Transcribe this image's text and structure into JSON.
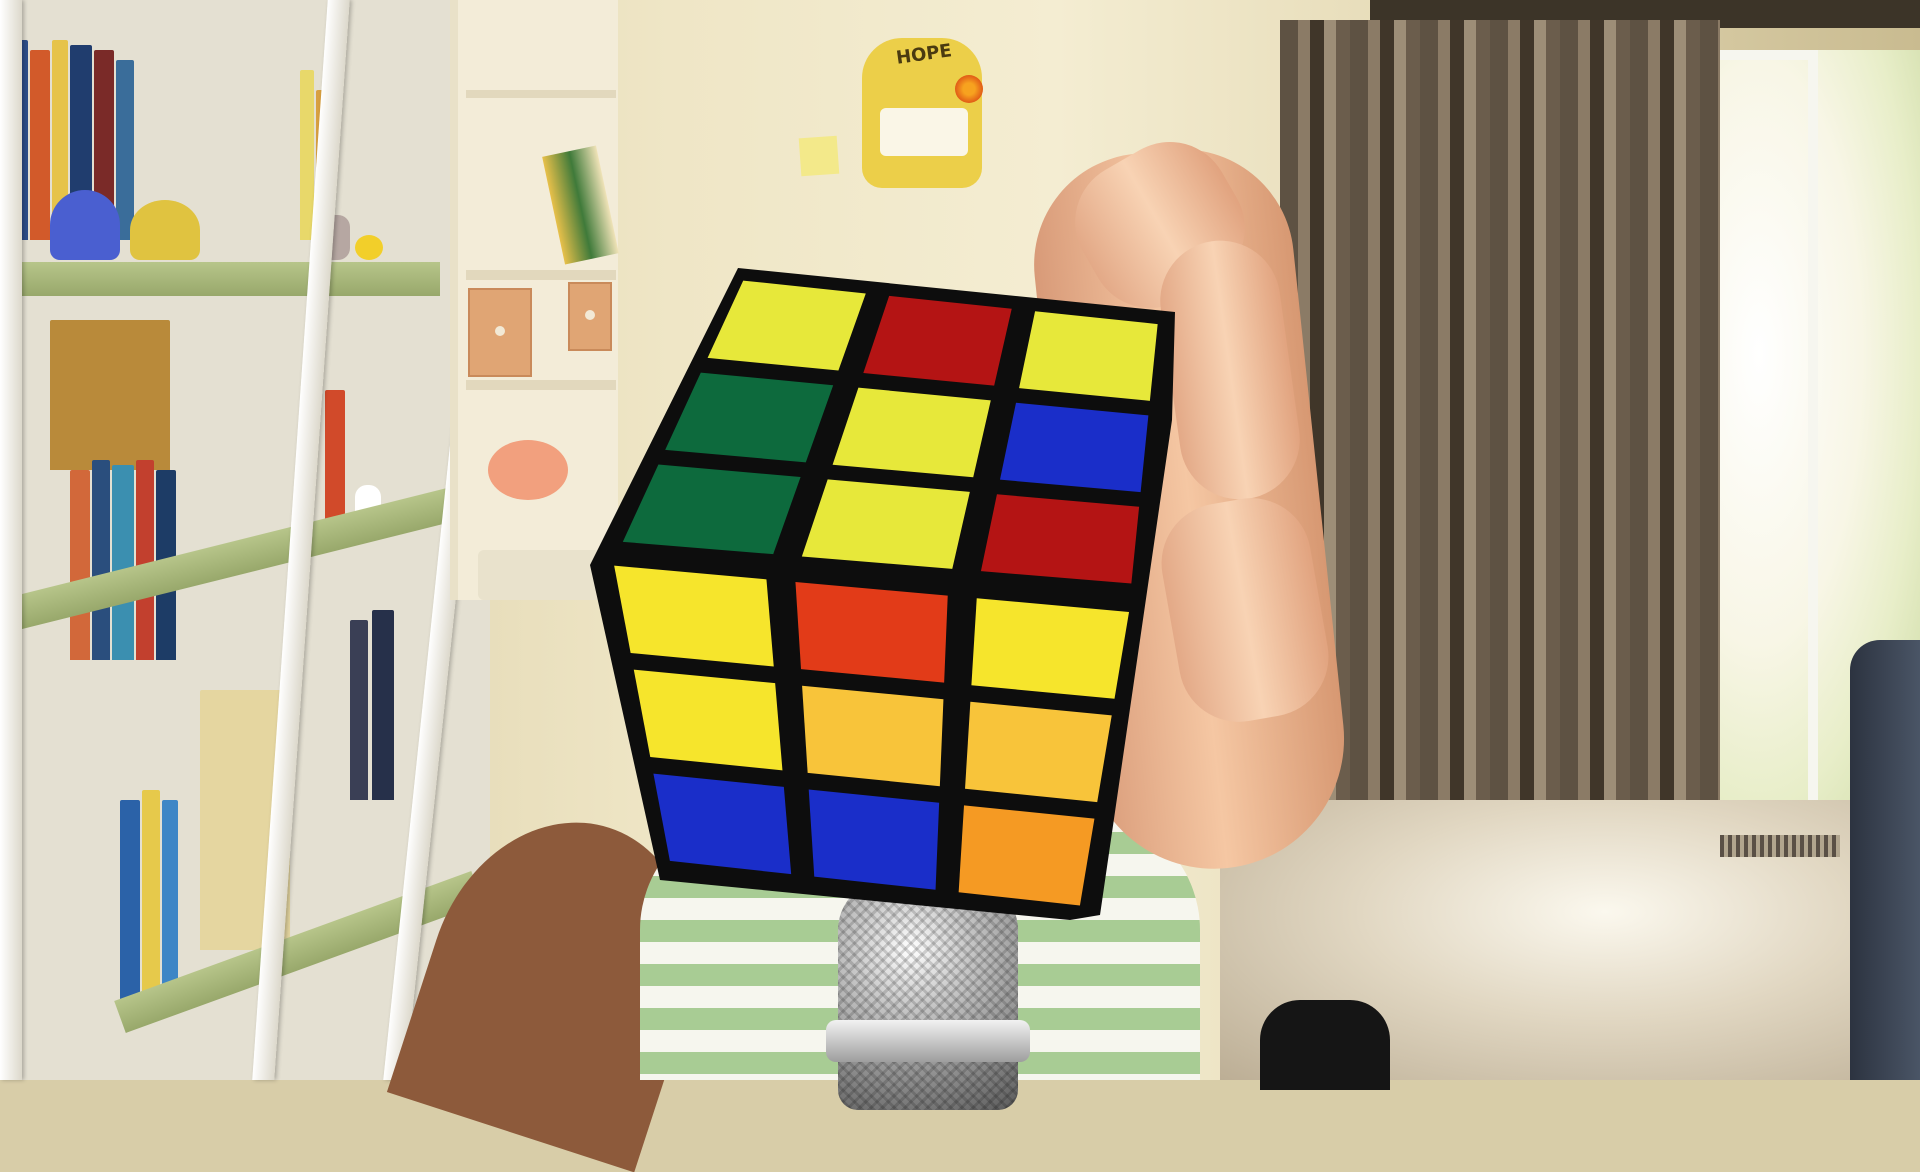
{
  "scene": {
    "plaque_text": "HOPE"
  },
  "cube": {
    "top_face": [
      [
        "yellow",
        "red",
        "yellow"
      ],
      [
        "green",
        "yellow",
        "blue"
      ],
      [
        "green",
        "yellow",
        "red"
      ]
    ],
    "front_face": [
      [
        "yellow",
        "red",
        "yellow"
      ],
      [
        "yellow",
        "orange",
        "orange"
      ],
      [
        "blue",
        "blue",
        "orange"
      ]
    ]
  },
  "colors": {
    "yellow": "#e7e83a",
    "red": "#b41414",
    "green": "#0d6a3d",
    "blue": "#1a2ec9",
    "orange": "#f59a23",
    "front_red": "#e23b18",
    "front_yellow": "#f6e52c",
    "front_yellow_orange": "#f8c43a",
    "dark_yellow": "#e3c92a"
  }
}
